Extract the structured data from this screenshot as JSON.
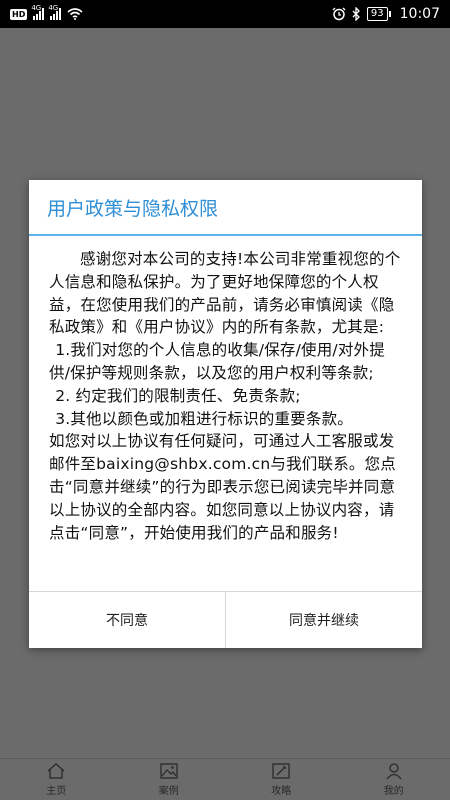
{
  "status_bar": {
    "hd": "HD",
    "net1": "4G",
    "net2": "4G",
    "battery": "93",
    "time": "10:07"
  },
  "dialog": {
    "title": "用户政策与隐私权限",
    "paragraphs": [
      "感谢您对本公司的支持!本公司非常重视您的个人信息和隐私保护。为了更好地保障您的个人权益，在您使用我们的产品前，请务必审慎阅读《隐私政策》和《用户协议》内的所有条款，尤其是:",
      "1.我们对您的个人信息的收集/保存/使用/对外提供/保护等规则条款，以及您的用户权利等条款;",
      "2. 约定我们的限制责任、免责条款;",
      "3.其他以颜色或加粗进行标识的重要条款。",
      "如您对以上协议有任何疑问，可通过人工客服或发邮件至baixing@shbx.com.cn与我们联系。您点击“同意并继续”的行为即表示您已阅读完毕并同意以上协议的全部内容。如您同意以上协议内容，请点击“同意”，开始使用我们的产品和服务!"
    ],
    "disagree_label": "不同意",
    "agree_label": "同意并继续"
  },
  "bottom_nav": {
    "items": [
      {
        "label": "主页",
        "icon": "home-icon"
      },
      {
        "label": "案例",
        "icon": "image-icon"
      },
      {
        "label": "攻略",
        "icon": "edit-icon"
      },
      {
        "label": "我的",
        "icon": "user-icon"
      }
    ]
  },
  "colors": {
    "accent": "#2e8fd6",
    "overlay": "#6b6b6b"
  }
}
